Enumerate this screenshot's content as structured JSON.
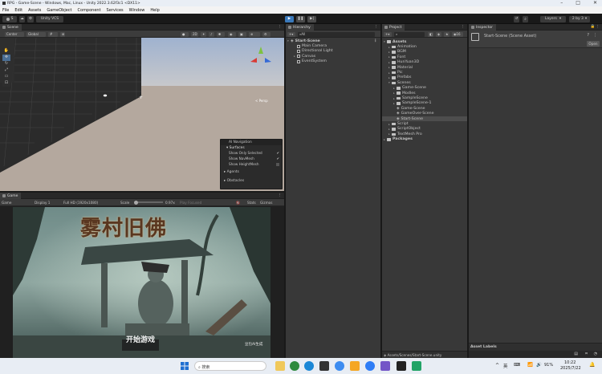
{
  "window": {
    "title": "RPG - Game-Scene - Windows, Mac, Linux - Unity 2022.3.62f3c1 <DX11>"
  },
  "menu": [
    "File",
    "Edit",
    "Assets",
    "GameObject",
    "Component",
    "Services",
    "Window",
    "Help"
  ],
  "toolbar": {
    "account": "S",
    "vcs": "Unity VCS",
    "layers": "Layers",
    "layout": "2 by 3"
  },
  "scene": {
    "tab": "Scene",
    "pivot": "Center",
    "space": "Global",
    "mode": "2D",
    "persp": "< Persp",
    "overlay": {
      "title": "AI Navigation",
      "section": "Surfaces",
      "items": [
        {
          "label": "Show Only Selected",
          "checked": "✔"
        },
        {
          "label": "Show NavMesh",
          "checked": "✔"
        },
        {
          "label": "Show HeightMesh",
          "checked": ""
        }
      ],
      "agents": "Agents",
      "obstacles": "Obstacles"
    }
  },
  "game": {
    "tab": "Game",
    "mode": "Game",
    "display": "Display 1",
    "resolution": "Full HD (1920x1080)",
    "scale_label": "Scale",
    "scale_value": "0.97x",
    "play_focused": "Play Focused",
    "stats": "Stats",
    "gizmos": "Gizmos",
    "title_art": "雾村旧佛",
    "start_label": "开始游戏",
    "watermark": "豆包AI生成"
  },
  "hierarchy": {
    "tab": "Hierarchy",
    "search": "All",
    "scene": "Start-Scene",
    "items": [
      "Main Camera",
      "Directional Light",
      "Canvas",
      "EventSystem"
    ]
  },
  "project": {
    "tab": "Project",
    "badge": "16",
    "rows": [
      {
        "label": "Assets",
        "level": 0,
        "kind": "folder",
        "bold": true
      },
      {
        "label": "Animation",
        "level": 1,
        "kind": "folder"
      },
      {
        "label": "BGM",
        "level": 1,
        "kind": "folder"
      },
      {
        "label": "Font",
        "level": 1,
        "kind": "folder"
      },
      {
        "label": "HunYuan3D",
        "level": 1,
        "kind": "folder"
      },
      {
        "label": "Material",
        "level": 1,
        "kind": "folder"
      },
      {
        "label": "Pic",
        "level": 1,
        "kind": "folder"
      },
      {
        "label": "Prefabs",
        "level": 1,
        "kind": "folder"
      },
      {
        "label": "Scenes",
        "level": 1,
        "kind": "folder"
      },
      {
        "label": "Game-Scene",
        "level": 2,
        "kind": "folder"
      },
      {
        "label": "Modles",
        "level": 2,
        "kind": "folder"
      },
      {
        "label": "SampleScene",
        "level": 2,
        "kind": "folder"
      },
      {
        "label": "SampleScene-1",
        "level": 2,
        "kind": "folder"
      },
      {
        "label": "Game-Scene",
        "level": 2,
        "kind": "scene"
      },
      {
        "label": "GameOver-Scene",
        "level": 2,
        "kind": "scene"
      },
      {
        "label": "Start-Scene",
        "level": 2,
        "kind": "scene",
        "selected": true
      },
      {
        "label": "Script",
        "level": 1,
        "kind": "folder"
      },
      {
        "label": "ScriptObject",
        "level": 1,
        "kind": "folder"
      },
      {
        "label": "TextMesh Pro",
        "level": 1,
        "kind": "folder"
      },
      {
        "label": "Packages",
        "level": 0,
        "kind": "folder",
        "bold": true
      }
    ],
    "footer_path": "Assets/Scenes/Start-Scene.unity"
  },
  "inspector": {
    "tab": "Inspector",
    "asset": "Start-Scene (Scene Asset)",
    "open_label": "Open",
    "asset_labels": "Asset Labels"
  },
  "taskbar": {
    "search": "搜索",
    "lang": "英",
    "battery": "91%",
    "time": "10:22",
    "date": "2025/7/22"
  },
  "colors": {
    "accent": "#3a79bb",
    "panel": "#383838",
    "dark": "#282828",
    "selection": "#4d4d4d"
  }
}
